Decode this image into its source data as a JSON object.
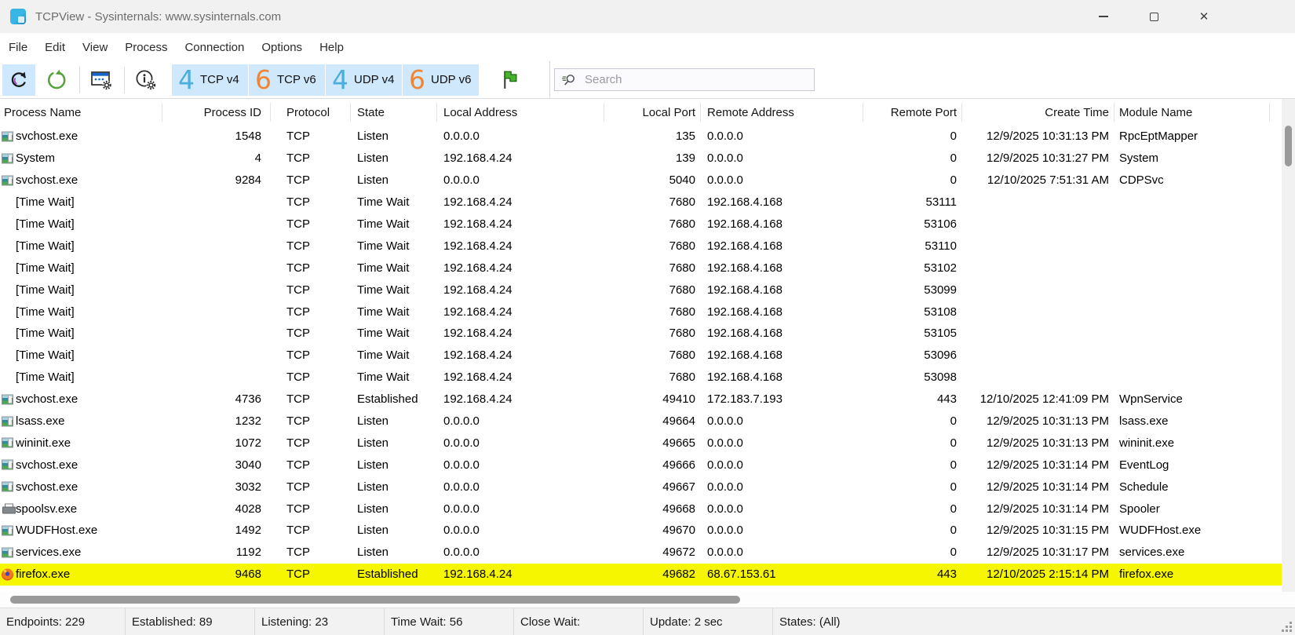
{
  "window": {
    "title": "TCPView - Sysinternals: www.sysinternals.com",
    "controls": {
      "close": "✕"
    }
  },
  "menu": {
    "items": [
      "File",
      "Edit",
      "View",
      "Process",
      "Connection",
      "Options",
      "Help"
    ]
  },
  "toolbar": {
    "toggles": [
      {
        "digit": "4",
        "label": "TCP v4",
        "digit_color": "#4aaede"
      },
      {
        "digit": "6",
        "label": "TCP v6",
        "digit_color": "#ef8636"
      },
      {
        "digit": "4",
        "label": "UDP v4",
        "digit_color": "#4aaede"
      },
      {
        "digit": "6",
        "label": "UDP v6",
        "digit_color": "#ef8636"
      }
    ],
    "search": {
      "placeholder": "Search",
      "value": ""
    }
  },
  "colors": {
    "toggle_background": "#cfe8fb",
    "selected_button_background": "#cde8ff",
    "highlight_row": "#f6f600",
    "accent_blue": "#4aaede",
    "accent_orange": "#ef8636",
    "flag_green": "#49b32e",
    "refresh_green": "#58a33c"
  },
  "table": {
    "columns": [
      "Process Name",
      "Process ID",
      "Protocol",
      "State",
      "Local Address",
      "Local Port",
      "Remote Address",
      "Remote Port",
      "Create Time",
      "Module Name"
    ],
    "rows": [
      {
        "icon": "service",
        "highlighted": false,
        "cells": [
          "svchost.exe",
          "1548",
          "TCP",
          "Listen",
          "0.0.0.0",
          "135",
          "0.0.0.0",
          "0",
          "12/9/2025 10:31:13 PM",
          "RpcEptMapper"
        ]
      },
      {
        "icon": "service",
        "highlighted": false,
        "cells": [
          "System",
          "4",
          "TCP",
          "Listen",
          "192.168.4.24",
          "139",
          "0.0.0.0",
          "0",
          "12/9/2025 10:31:27 PM",
          "System"
        ]
      },
      {
        "icon": "service",
        "highlighted": false,
        "cells": [
          "svchost.exe",
          "9284",
          "TCP",
          "Listen",
          "0.0.0.0",
          "5040",
          "0.0.0.0",
          "0",
          "12/10/2025 7:51:31 AM",
          "CDPSvc"
        ]
      },
      {
        "icon": null,
        "highlighted": false,
        "cells": [
          "[Time Wait]",
          "",
          "TCP",
          "Time Wait",
          "192.168.4.24",
          "7680",
          "192.168.4.168",
          "53111",
          "",
          ""
        ]
      },
      {
        "icon": null,
        "highlighted": false,
        "cells": [
          "[Time Wait]",
          "",
          "TCP",
          "Time Wait",
          "192.168.4.24",
          "7680",
          "192.168.4.168",
          "53106",
          "",
          ""
        ]
      },
      {
        "icon": null,
        "highlighted": false,
        "cells": [
          "[Time Wait]",
          "",
          "TCP",
          "Time Wait",
          "192.168.4.24",
          "7680",
          "192.168.4.168",
          "53110",
          "",
          ""
        ]
      },
      {
        "icon": null,
        "highlighted": false,
        "cells": [
          "[Time Wait]",
          "",
          "TCP",
          "Time Wait",
          "192.168.4.24",
          "7680",
          "192.168.4.168",
          "53102",
          "",
          ""
        ]
      },
      {
        "icon": null,
        "highlighted": false,
        "cells": [
          "[Time Wait]",
          "",
          "TCP",
          "Time Wait",
          "192.168.4.24",
          "7680",
          "192.168.4.168",
          "53099",
          "",
          ""
        ]
      },
      {
        "icon": null,
        "highlighted": false,
        "cells": [
          "[Time Wait]",
          "",
          "TCP",
          "Time Wait",
          "192.168.4.24",
          "7680",
          "192.168.4.168",
          "53108",
          "",
          ""
        ]
      },
      {
        "icon": null,
        "highlighted": false,
        "cells": [
          "[Time Wait]",
          "",
          "TCP",
          "Time Wait",
          "192.168.4.24",
          "7680",
          "192.168.4.168",
          "53105",
          "",
          ""
        ]
      },
      {
        "icon": null,
        "highlighted": false,
        "cells": [
          "[Time Wait]",
          "",
          "TCP",
          "Time Wait",
          "192.168.4.24",
          "7680",
          "192.168.4.168",
          "53096",
          "",
          ""
        ]
      },
      {
        "icon": null,
        "highlighted": false,
        "cells": [
          "[Time Wait]",
          "",
          "TCP",
          "Time Wait",
          "192.168.4.24",
          "7680",
          "192.168.4.168",
          "53098",
          "",
          ""
        ]
      },
      {
        "icon": "service",
        "highlighted": false,
        "cells": [
          "svchost.exe",
          "4736",
          "TCP",
          "Established",
          "192.168.4.24",
          "49410",
          "172.183.7.193",
          "443",
          "12/10/2025 12:41:09 PM",
          "WpnService"
        ]
      },
      {
        "icon": "service",
        "highlighted": false,
        "cells": [
          "lsass.exe",
          "1232",
          "TCP",
          "Listen",
          "0.0.0.0",
          "49664",
          "0.0.0.0",
          "0",
          "12/9/2025 10:31:13 PM",
          "lsass.exe"
        ]
      },
      {
        "icon": "service",
        "highlighted": false,
        "cells": [
          "wininit.exe",
          "1072",
          "TCP",
          "Listen",
          "0.0.0.0",
          "49665",
          "0.0.0.0",
          "0",
          "12/9/2025 10:31:13 PM",
          "wininit.exe"
        ]
      },
      {
        "icon": "service",
        "highlighted": false,
        "cells": [
          "svchost.exe",
          "3040",
          "TCP",
          "Listen",
          "0.0.0.0",
          "49666",
          "0.0.0.0",
          "0",
          "12/9/2025 10:31:14 PM",
          "EventLog"
        ]
      },
      {
        "icon": "service",
        "highlighted": false,
        "cells": [
          "svchost.exe",
          "3032",
          "TCP",
          "Listen",
          "0.0.0.0",
          "49667",
          "0.0.0.0",
          "0",
          "12/9/2025 10:31:14 PM",
          "Schedule"
        ]
      },
      {
        "icon": "printer",
        "highlighted": false,
        "cells": [
          "spoolsv.exe",
          "4028",
          "TCP",
          "Listen",
          "0.0.0.0",
          "49668",
          "0.0.0.0",
          "0",
          "12/9/2025 10:31:14 PM",
          "Spooler"
        ]
      },
      {
        "icon": "service",
        "highlighted": false,
        "cells": [
          "WUDFHost.exe",
          "1492",
          "TCP",
          "Listen",
          "0.0.0.0",
          "49670",
          "0.0.0.0",
          "0",
          "12/9/2025 10:31:15 PM",
          "WUDFHost.exe"
        ]
      },
      {
        "icon": "service",
        "highlighted": false,
        "cells": [
          "services.exe",
          "1192",
          "TCP",
          "Listen",
          "0.0.0.0",
          "49672",
          "0.0.0.0",
          "0",
          "12/9/2025 10:31:17 PM",
          "services.exe"
        ]
      },
      {
        "icon": "firefox",
        "highlighted": true,
        "cells": [
          "firefox.exe",
          "9468",
          "TCP",
          "Established",
          "192.168.4.24",
          "49682",
          "68.67.153.61",
          "443",
          "12/10/2025 2:15:14 PM",
          "firefox.exe"
        ]
      }
    ]
  },
  "status_bar": {
    "items": [
      "Endpoints: 229",
      "Established: 89",
      "Listening: 23",
      "Time Wait: 56",
      "Close Wait:",
      "Update: 2 sec",
      "States: (All)"
    ]
  }
}
